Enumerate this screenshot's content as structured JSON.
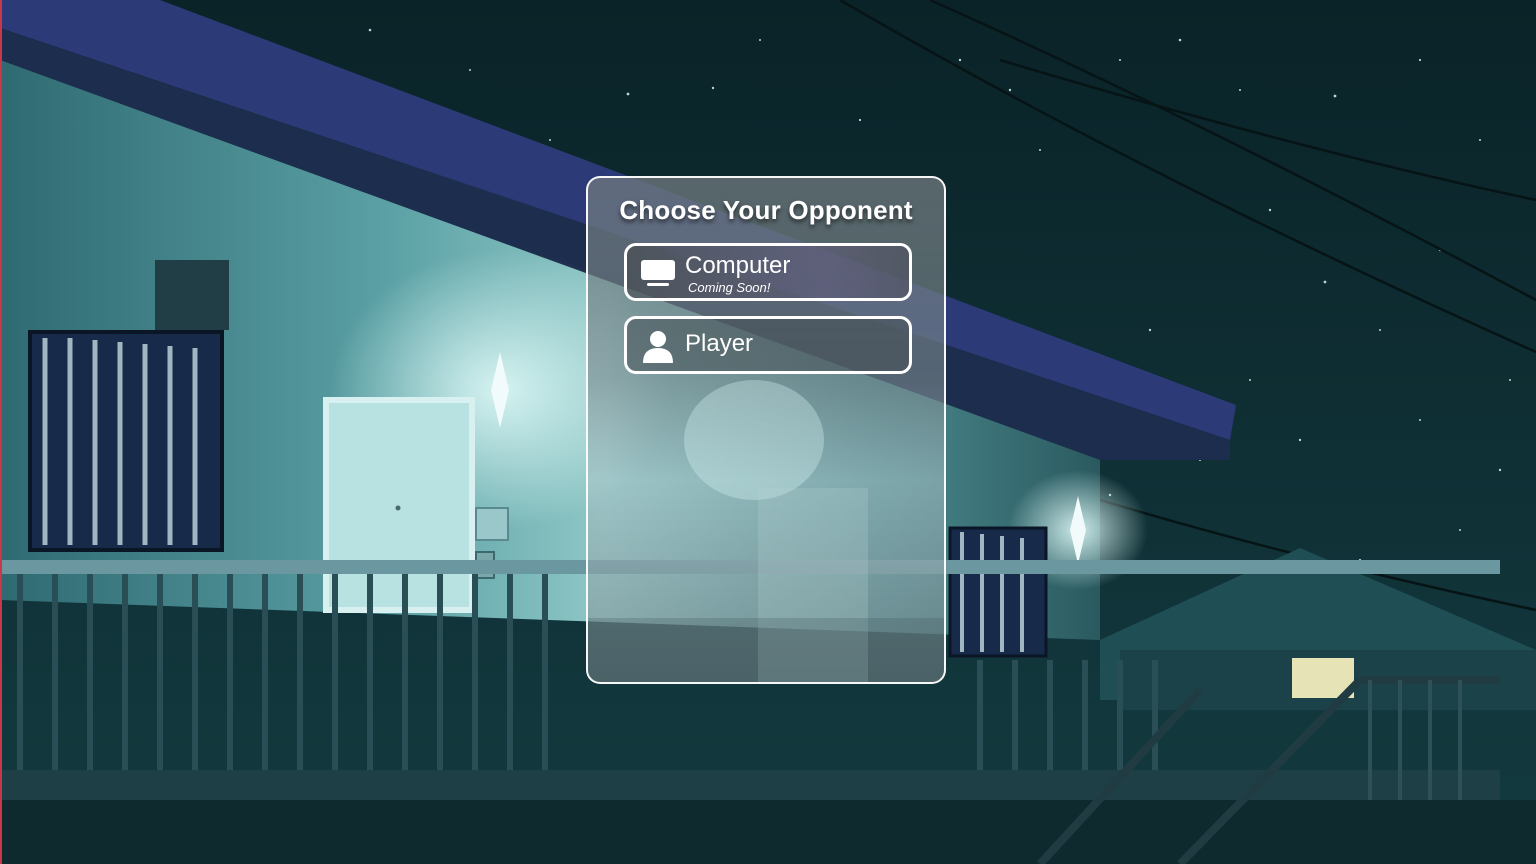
{
  "dialog": {
    "title": "Choose Your Opponent",
    "options": [
      {
        "label": "Computer",
        "sublabel": "Coming Soon!",
        "icon": "computer-icon"
      },
      {
        "label": "Player",
        "sublabel": "",
        "icon": "user-icon"
      }
    ]
  },
  "colors": {
    "panel_border": "#ffffff",
    "text": "#ffffff",
    "night_sky": "#0c2a30"
  }
}
